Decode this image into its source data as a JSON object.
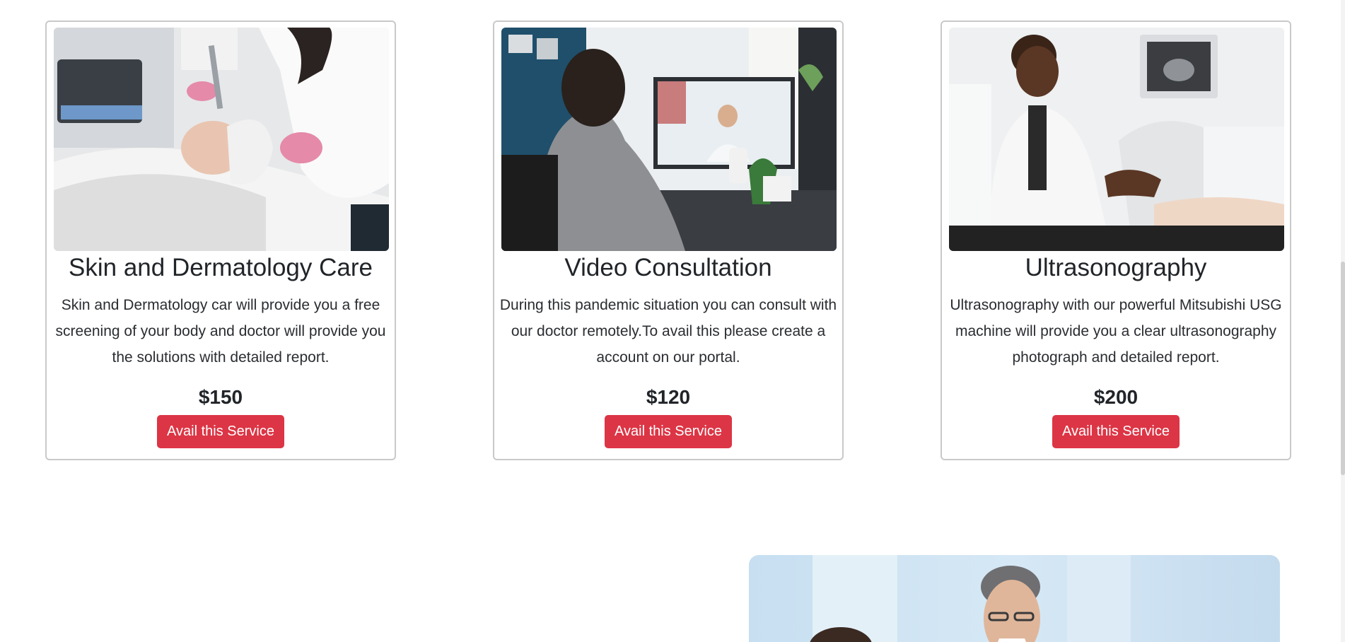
{
  "services": [
    {
      "image_alt": "Dermatologist treating a patient's face",
      "title": "Skin and Dermatology Care",
      "description": "Skin and Dermatology car will provide you a free screening of your body and doctor will provide you the solutions with detailed report.",
      "price": "$150",
      "button_label": "Avail this Service"
    },
    {
      "image_alt": "Woman on a video call with a doctor",
      "title": "Video Consultation",
      "description": "During this pandemic situation you can consult with our doctor remotely.To avail this please create a account on our portal.",
      "price": "$120",
      "button_label": "Avail this Service"
    },
    {
      "image_alt": "Doctor operating an ultrasound machine",
      "title": "Ultrasonography",
      "description": "Ultrasonography with our powerful Mitsubishi USG machine will provide you a clear ultrasonography photograph and detailed report.",
      "price": "$200",
      "button_label": "Avail this Service"
    }
  ],
  "colors": {
    "button_bg": "#dc3545",
    "card_border": "#c9c9c9",
    "text": "#212529"
  }
}
